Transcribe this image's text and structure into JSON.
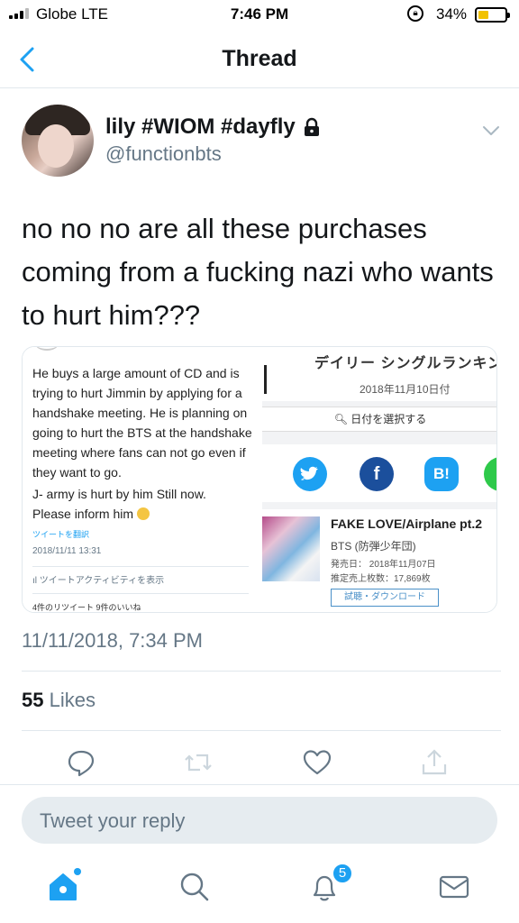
{
  "status_bar": {
    "carrier": "Globe  LTE",
    "time": "7:46 PM",
    "battery_percent": "34%",
    "battery_level": 0.34,
    "icons": [
      "signal-icon",
      "rotation-lock-icon",
      "battery-icon"
    ]
  },
  "header": {
    "title": "Thread",
    "back_icon": "chevron-left-icon"
  },
  "tweet": {
    "display_name": "lily #WIOM #dayfly",
    "handle": "@functionbts",
    "protected_icon": "lock-icon",
    "text": "no no no are all these purchases coming from a fucking nazi who wants to hurt him???",
    "timestamp": "11/11/2018, 7:34 PM",
    "likes_count": "55",
    "likes_label": "Likes"
  },
  "media_left": {
    "paragraph1": "He buys a large amount of CD and is trying to hurt Jimmin by applying for a handshake meeting. He is planning on going to hurt the BTS at the handshake meeting where fans can not go even if they want to go.",
    "paragraph2_line1": "J- army is hurt by him Still now.",
    "paragraph2_line2": "Please inform him",
    "translate_link": "ツイートを翻訳",
    "datetime": "2018/11/11 13:31",
    "activity": "ツイートアクティビティを表示",
    "stats": "4件のリツイート  9件のいいね"
  },
  "media_right": {
    "title": "デイリー シングルランキング",
    "date": "2018年11月10日付",
    "date_select": "日付を選択する",
    "social": [
      "f",
      "B!",
      "L"
    ],
    "song_title": "FAKE LOVE/Airplane pt.2",
    "artist": "BTS (防弾少年団)",
    "release": "発売日： 2018年11月07日",
    "sales": "推定売上枚数：17,869枚",
    "download": "試聴・ダウンロード"
  },
  "reply": {
    "placeholder": "Tweet your reply"
  },
  "tabbar": {
    "notification_count": "5",
    "tabs": [
      "home-icon",
      "search-icon",
      "notifications-icon",
      "messages-icon"
    ]
  },
  "colors": {
    "accent": "#1da1f2",
    "text_primary": "#14171a",
    "text_secondary": "#657786",
    "divider": "#e1e8ed"
  }
}
